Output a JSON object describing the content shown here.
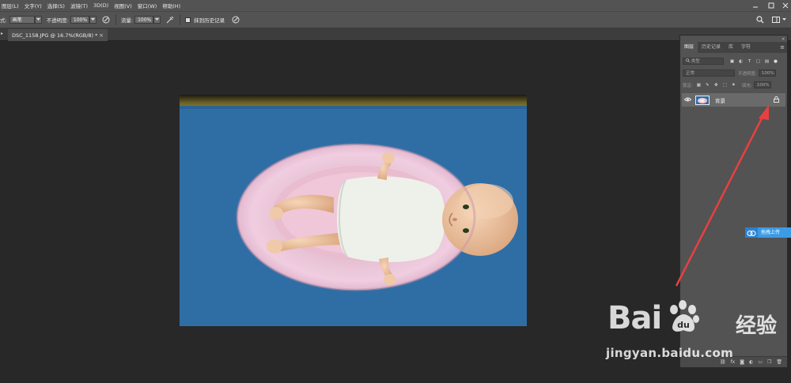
{
  "menubar": {
    "items": [
      "图层(L)",
      "文字(Y)",
      "选择(S)",
      "滤镜(T)",
      "3D(D)",
      "视图(V)",
      "窗口(W)",
      "帮助(H)"
    ]
  },
  "options_bar": {
    "mode_label": "式:",
    "mode_value": "画笔",
    "opacity_label": "不透明度:",
    "opacity_value": "100%",
    "flow_label": "流量:",
    "flow_value": "100%",
    "erase_history_label": "抹到历史记录"
  },
  "document_tab": {
    "title": "DSC_1158.JPG @ 16.7%(RGB/8) *",
    "close": "×"
  },
  "layers_panel": {
    "tabs": [
      "图层",
      "历史记录",
      "库",
      "字符"
    ],
    "menu_icon": "≡",
    "collapse": "«",
    "filter_placeholder": "类型",
    "blend_mode": "正常",
    "opacity_label": "不透明度:",
    "opacity_value": "100%",
    "lock_label": "锁定:",
    "fill_label": "填充:",
    "fill_value": "100%",
    "layer": {
      "name": "背景"
    }
  },
  "upload_widget": {
    "label": "拖拽上传"
  },
  "watermark": {
    "logo_text_left": "Bai",
    "logo_text_right": "经验",
    "url": "jingyan.baidu.com"
  },
  "colors": {
    "ui_bg": "#535353",
    "canvas_bg": "#282828",
    "annotation_arrow": "#e84040",
    "upload_accent": "#3c9be6"
  }
}
